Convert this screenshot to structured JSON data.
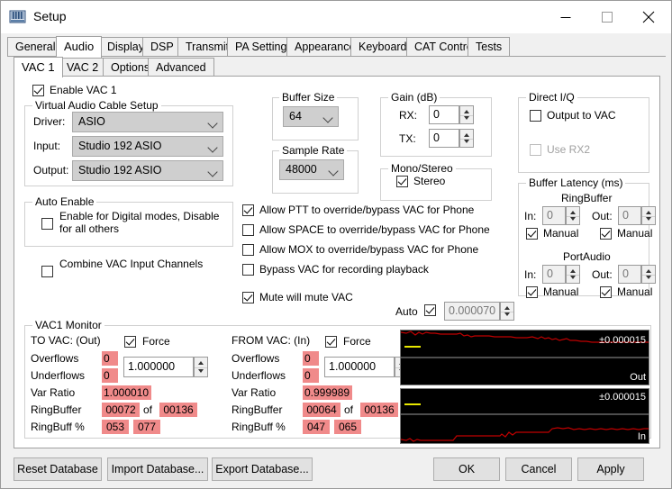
{
  "window": {
    "title": "Setup",
    "icon": "app-icon",
    "minimize": "minimize-icon",
    "maximize": "maximize-icon",
    "close": "close-icon"
  },
  "tabs_main": [
    {
      "label": "General",
      "selected": false
    },
    {
      "label": "Audio",
      "selected": true
    },
    {
      "label": "Display",
      "selected": false
    },
    {
      "label": "DSP",
      "selected": false
    },
    {
      "label": "Transmit",
      "selected": false
    },
    {
      "label": "PA Settings",
      "selected": false
    },
    {
      "label": "Appearance",
      "selected": false
    },
    {
      "label": "Keyboard",
      "selected": false
    },
    {
      "label": "CAT Control",
      "selected": false
    },
    {
      "label": "Tests",
      "selected": false
    }
  ],
  "tabs_sub": [
    {
      "label": "VAC 1",
      "selected": true
    },
    {
      "label": "VAC 2",
      "selected": false
    },
    {
      "label": "Options",
      "selected": false
    },
    {
      "label": "Advanced",
      "selected": false
    }
  ],
  "enable_vac1": {
    "label": "Enable VAC 1",
    "checked": true
  },
  "vac_cable": {
    "title": "Virtual Audio Cable Setup",
    "driver_label": "Driver:",
    "driver_value": "ASIO",
    "input_label": "Input:",
    "input_value": "Studio 192 ASIO",
    "output_label": "Output:",
    "output_value": "Studio 192 ASIO"
  },
  "auto_enable": {
    "title": "Auto Enable",
    "checkbox_label": "Enable for Digital modes, Disable for all others",
    "checked": false
  },
  "combine_vac": {
    "label": "Combine VAC Input Channels",
    "checked": false
  },
  "buffer_size": {
    "title": "Buffer Size",
    "value": "64"
  },
  "sample_rate": {
    "title": "Sample Rate",
    "value": "48000"
  },
  "gain": {
    "title": "Gain (dB)",
    "rx_label": "RX:",
    "rx_value": "0",
    "tx_label": "TX:",
    "tx_value": "0"
  },
  "mono_stereo": {
    "title": "Mono/Stereo",
    "stereo_label": "Stereo",
    "stereo_checked": true
  },
  "direct_iq": {
    "title": "Direct I/Q",
    "output_to_vac_label": "Output to VAC",
    "output_to_vac_checked": false,
    "use_rx2_label": "Use RX2",
    "use_rx2_checked": false,
    "use_rx2_enabled": false
  },
  "buffer_latency": {
    "title": "Buffer Latency (ms)",
    "ringbuffer_title": "RingBuffer",
    "portaudio_title": "PortAudio",
    "in_label": "In:",
    "out_label": "Out:",
    "manual_label": "Manual",
    "ring_in": "0",
    "ring_out": "0",
    "ring_in_manual": true,
    "ring_out_manual": true,
    "port_in": "0",
    "port_out": "0",
    "port_in_manual": true,
    "port_out_manual": true
  },
  "override_options": [
    {
      "label": "Allow PTT to override/bypass VAC for Phone",
      "checked": true
    },
    {
      "label": "Allow SPACE to override/bypass VAC for Phone",
      "checked": false
    },
    {
      "label": "Allow MOX to override/bypass VAC for Phone",
      "checked": false
    },
    {
      "label": "Bypass VAC for recording playback",
      "checked": false
    }
  ],
  "mute_vac": {
    "label": "Mute will mute VAC",
    "checked": true
  },
  "auto_row": {
    "label": "Auto",
    "checked": true,
    "value": "0.000070"
  },
  "monitor": {
    "title": "VAC1 Monitor",
    "out": {
      "heading": "TO VAC: (Out)",
      "force_label": "Force",
      "force_checked": true,
      "force_value": "1.000000",
      "rows": [
        {
          "label": "Overflows",
          "value": "0"
        },
        {
          "label": "Underflows",
          "value": "0"
        },
        {
          "label": "Var Ratio",
          "value": "1.000010"
        }
      ],
      "ringbuffer_label": "RingBuffer",
      "ringbuffer_value": "00072",
      "ringbuffer_of": "of",
      "ringbuffer_total": "00136",
      "ringbuff_pct_label": "RingBuff %",
      "ringbuff_pct_a": "053",
      "ringbuff_pct_b": "077"
    },
    "in": {
      "heading": "FROM VAC: (In)",
      "force_label": "Force",
      "force_checked": true,
      "force_value": "1.000000",
      "rows": [
        {
          "label": "Overflows",
          "value": "0"
        },
        {
          "label": "Underflows",
          "value": "0"
        },
        {
          "label": "Var Ratio",
          "value": "0.999989"
        }
      ],
      "ringbuffer_label": "RingBuffer",
      "ringbuffer_value": "00064",
      "ringbuffer_of": "of",
      "ringbuffer_total": "00136",
      "ringbuff_pct_label": "RingBuff %",
      "ringbuff_pct_a": "047",
      "ringbuff_pct_b": "065"
    },
    "graph_out": {
      "scale": "±0.000015",
      "name": "Out"
    },
    "graph_in": {
      "scale": "±0.000015",
      "name": "In"
    }
  },
  "footer": {
    "reset_db": "Reset Database",
    "import_db": "Import Database...",
    "export_db": "Export Database...",
    "ok": "OK",
    "cancel": "Cancel",
    "apply": "Apply"
  },
  "colors": {
    "highlight": "#f08a8a",
    "trace": "#c00000",
    "marker": "#e8e800",
    "graph_bg": "#000000"
  }
}
